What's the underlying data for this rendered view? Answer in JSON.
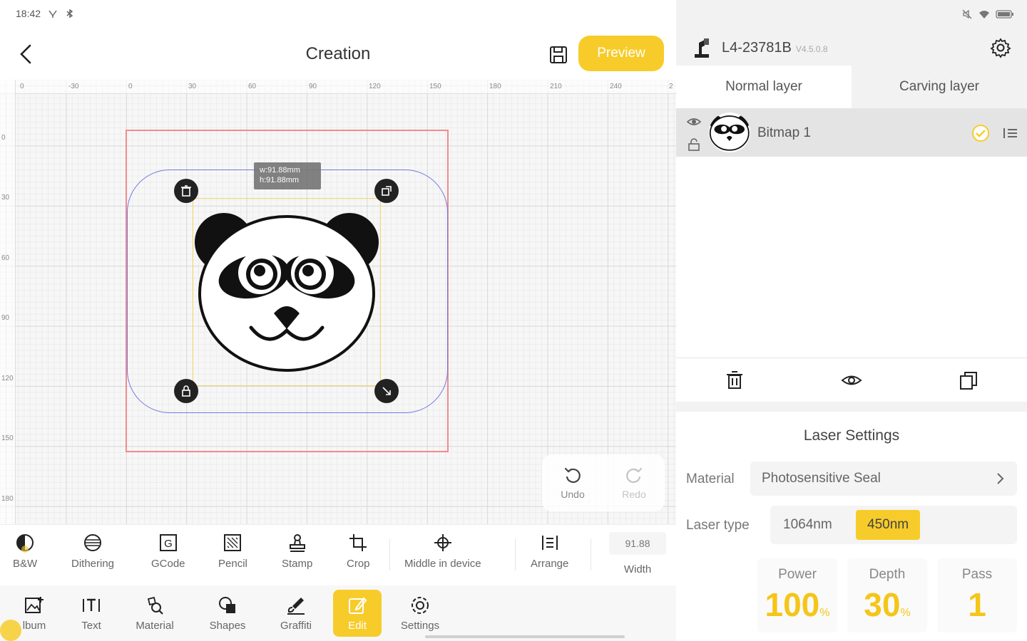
{
  "status_bar": {
    "time": "18:42"
  },
  "header": {
    "title": "Creation",
    "preview_label": "Preview"
  },
  "canvas": {
    "ruler_top_ticks": [
      "0",
      "-30",
      "0",
      "30",
      "60",
      "90",
      "120",
      "150",
      "180",
      "210",
      "240",
      "2"
    ],
    "ruler_left_ticks": [
      "0",
      "30",
      "60",
      "90",
      "120",
      "150",
      "180"
    ],
    "size_tooltip": {
      "width": "w:91.88mm",
      "height": "h:91.88mm"
    }
  },
  "history": {
    "undo_label": "Undo",
    "redo_label": "Redo"
  },
  "toolbar": {
    "items": [
      {
        "label": "B&W",
        "icon": "bw-icon"
      },
      {
        "label": "Dithering",
        "icon": "dithering-icon"
      },
      {
        "label": "GCode",
        "icon": "gcode-icon"
      },
      {
        "label": "Pencil",
        "icon": "pencil-icon"
      },
      {
        "label": "Stamp",
        "icon": "stamp-icon"
      },
      {
        "label": "Crop",
        "icon": "crop-icon"
      },
      {
        "label": "Middle in device",
        "icon": "center-icon"
      },
      {
        "label": "Arrange",
        "icon": "arrange-icon"
      }
    ],
    "width_value": "91.88",
    "width_label": "Width"
  },
  "bottom_toolbar": {
    "items": [
      {
        "label": "lbum",
        "icon": "album-icon"
      },
      {
        "label": "Text",
        "icon": "text-icon"
      },
      {
        "label": "Material",
        "icon": "material-icon"
      },
      {
        "label": "Shapes",
        "icon": "shapes-icon"
      },
      {
        "label": "Graffiti",
        "icon": "graffiti-icon"
      },
      {
        "label": "Edit",
        "icon": "edit-icon",
        "active": true
      },
      {
        "label": "Settings",
        "icon": "settings-icon"
      }
    ]
  },
  "device": {
    "name": "L4-23781B",
    "version": "V4.5.0.8"
  },
  "layer_tabs": [
    {
      "label": "Normal layer",
      "active": true
    },
    {
      "label": "Carving layer",
      "active": false
    }
  ],
  "layers": [
    {
      "name": "Bitmap 1",
      "selected": true
    }
  ],
  "laser_settings": {
    "title": "Laser Settings",
    "material_label": "Material",
    "material_value": "Photosensitive Seal",
    "laser_type_label": "Laser type",
    "laser_type_options": [
      "1064nm",
      "450nm"
    ],
    "laser_type_selected": "450nm",
    "power_label": "Power",
    "power_value": "100",
    "depth_label": "Depth",
    "depth_value": "30",
    "pass_label": "Pass",
    "pass_value": "1",
    "percent_unit": "%"
  },
  "colors": {
    "accent": "#f7cc2a",
    "work_area_border": "#f28b8b",
    "path_border": "#7078e0",
    "selection_border": "#f1d66a"
  }
}
